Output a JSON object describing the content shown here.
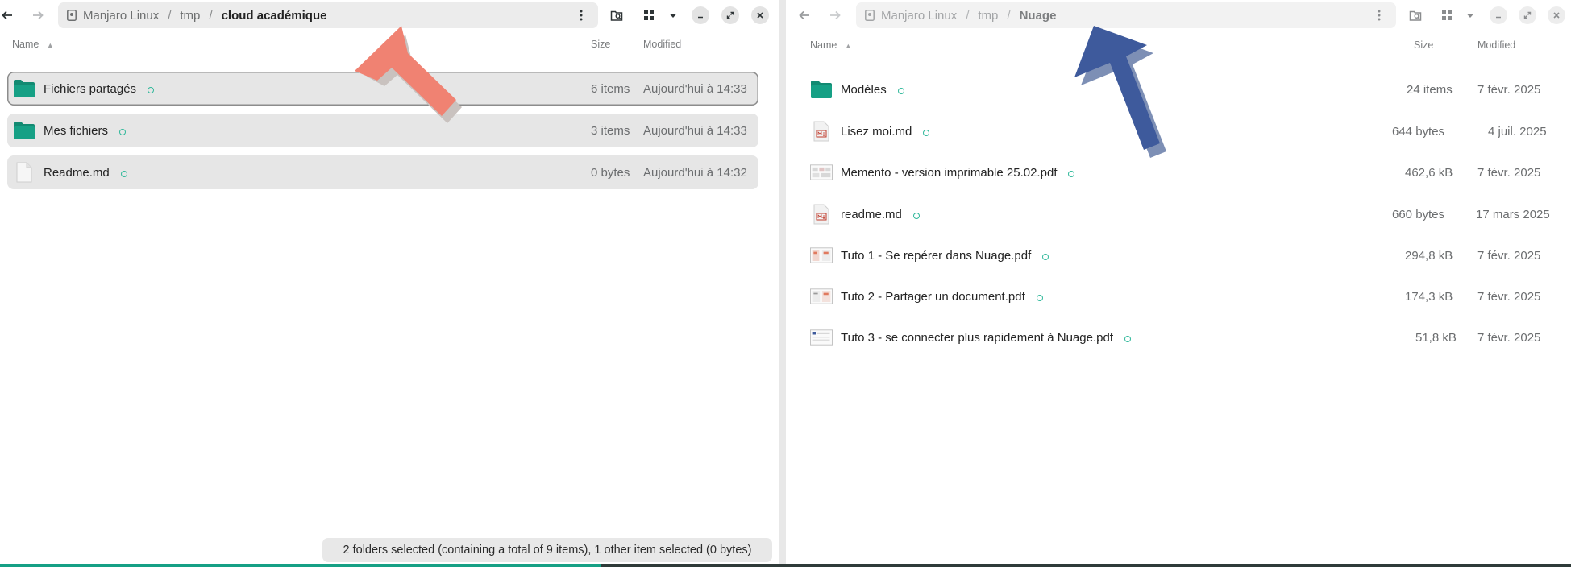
{
  "left": {
    "path": {
      "root": "Manjaro Linux",
      "mid": "tmp",
      "current": "cloud académique"
    },
    "columns": {
      "name": "Name",
      "size": "Size",
      "modified": "Modified"
    },
    "rows": [
      {
        "name": "Fichiers partagés",
        "size": "6 items",
        "modified": "Aujourd'hui à 14:33",
        "type": "folder"
      },
      {
        "name": "Mes fichiers",
        "size": "3 items",
        "modified": "Aujourd'hui à 14:33",
        "type": "folder"
      },
      {
        "name": "Readme.md",
        "size": "0 bytes",
        "modified": "Aujourd'hui à 14:32",
        "type": "file"
      }
    ],
    "status": "2 folders selected (containing a total of 9 items), 1 other item selected (0 bytes)"
  },
  "right": {
    "path": {
      "root": "Manjaro Linux",
      "mid": "tmp",
      "current": "Nuage"
    },
    "columns": {
      "name": "Name",
      "size": "Size",
      "modified": "Modified"
    },
    "rows": [
      {
        "name": "Modèles",
        "size": "24 items",
        "modified": "7 févr. 2025",
        "type": "folder"
      },
      {
        "name": "Lisez moi.md",
        "size": "644 bytes",
        "modified": "4 juil. 2025",
        "type": "md"
      },
      {
        "name": "Memento - version imprimable 25.02.pdf",
        "size": "462,6 kB",
        "modified": "7 févr. 2025",
        "type": "pdf"
      },
      {
        "name": "readme.md",
        "size": "660 bytes",
        "modified": "17 mars 2025",
        "type": "md"
      },
      {
        "name": "Tuto 1 - Se repérer dans Nuage.pdf",
        "size": "294,8 kB",
        "modified": "7 févr. 2025",
        "type": "pdf"
      },
      {
        "name": "Tuto 2 - Partager un document.pdf",
        "size": "174,3 kB",
        "modified": "7 févr. 2025",
        "type": "pdf"
      },
      {
        "name": "Tuto 3 - se connecter plus rapidement à Nuage.pdf",
        "size": "51,8 kB",
        "modified": "7 févr. 2025",
        "type": "pdf"
      }
    ]
  },
  "colors": {
    "folder": "#16a085",
    "arrow_left": "#f08272",
    "arrow_right": "#3e5a9c",
    "selection": "#e6e6e6"
  },
  "icons": [
    "back-arrow-icon",
    "forward-arrow-icon",
    "drive-icon",
    "kebab-menu-icon",
    "search-folder-icon",
    "grid-view-icon",
    "chevron-down-icon",
    "minimize-icon",
    "maximize-icon",
    "close-icon",
    "folder-icon",
    "file-icon",
    "sync-emblem-icon"
  ]
}
